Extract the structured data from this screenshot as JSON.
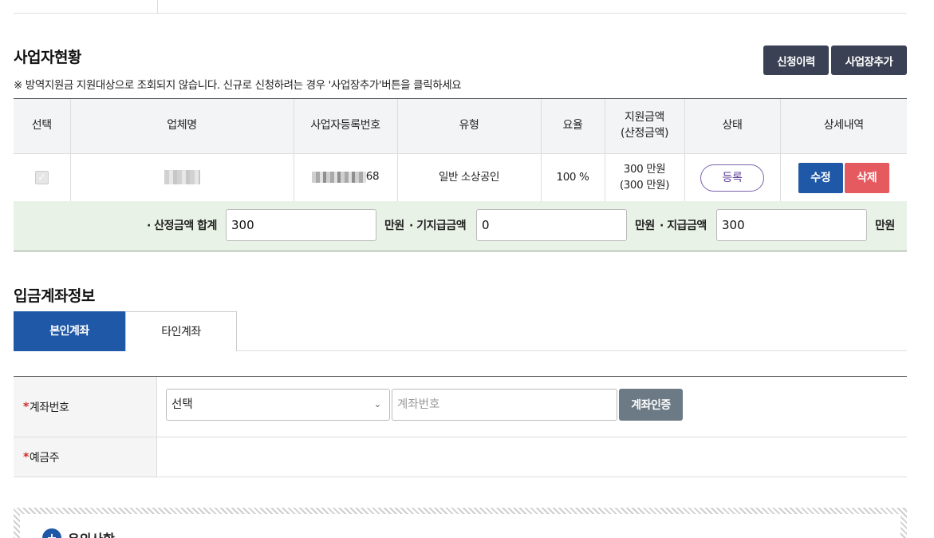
{
  "business": {
    "title": "사업자현황",
    "notice": "※ 방역지원금 지원대상으로 조회되지 않습니다. 신규로 신청하려는 경우 '사업장추가'버튼을 클릭하세요",
    "history_button": "신청이력",
    "add_button": "사업장추가",
    "columns": [
      "선택",
      "업체명",
      "사업자등록번호",
      "유형",
      "요율",
      "지원금액",
      "(산정금액)",
      "상태",
      "상세내역"
    ],
    "rows": [
      {
        "selected": true,
        "company_name": "",
        "reg_no_tail": "68",
        "type": "일반 소상공인",
        "rate": "100 %",
        "amount": "300 만원",
        "calc_amount": "(300 만원)",
        "status": "등록",
        "edit_label": "수정",
        "delete_label": "삭제"
      }
    ]
  },
  "summary": {
    "calc_total_label": "· 산정금액 합계",
    "calc_total_value": "300",
    "unit1": "만원",
    "paid_label": "· 기지급금액",
    "paid_value": "0",
    "unit2": "만원",
    "payout_label": "· 지급금액",
    "payout_value": "300",
    "unit3": "만원"
  },
  "account": {
    "title": "입금계좌정보",
    "tabs": [
      {
        "label": "본인계좌",
        "active": true
      },
      {
        "label": "타인계좌",
        "active": false
      }
    ],
    "req_mark": "*",
    "account_label": "계좌번호",
    "bank_select_value": "선택",
    "account_placeholder": "계좌번호",
    "verify_button": "계좌인증",
    "holder_label": "예금주"
  },
  "guide": {
    "icon": "plus-circle-icon",
    "title": "유의사항"
  },
  "colors": {
    "primary": "#1f58a6",
    "dark_button": "#3a4154",
    "delete": "#e55a5f",
    "summary_bg": "#e9f2e7",
    "status_border": "#7a62ad"
  }
}
